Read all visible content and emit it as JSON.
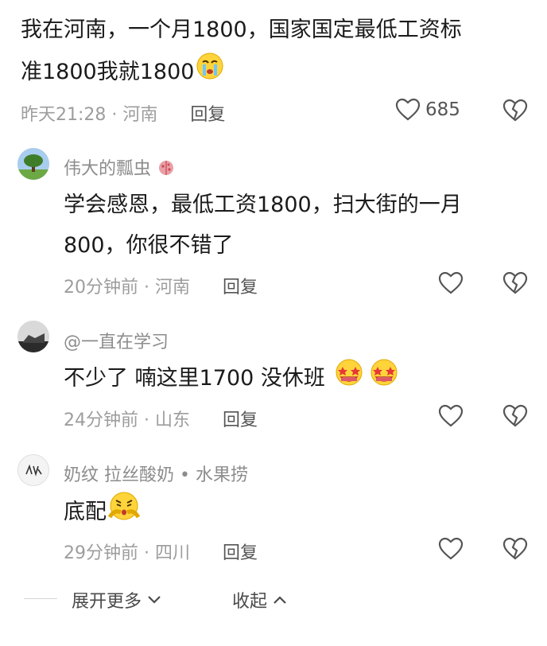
{
  "main_comment": {
    "line1": "我在河南，一个月1800，国家国定最低工资标",
    "line2": "准1800我就1800",
    "time": "昨天21:28",
    "location": "河南",
    "reply_label": "回复",
    "likes": "685"
  },
  "replies": [
    {
      "username": "伟大的瓢虫",
      "line1": "学会感恩，最低工资1800，扫大街的一月",
      "line2": "800，你很不错了",
      "time": "20分钟前",
      "location": "河南",
      "reply_label": "回复"
    },
    {
      "username": "@一直在学习",
      "line1": "不少了 喃这里1700 没休班",
      "time": "24分钟前",
      "location": "山东",
      "reply_label": "回复"
    },
    {
      "username": "奶纹 拉丝酸奶 • 水果捞",
      "line1": "底配",
      "time": "29分钟前",
      "location": "四川",
      "reply_label": "回复"
    }
  ],
  "footer": {
    "expand_label": "展开更多",
    "collapse_label": "收起"
  },
  "icons": {
    "like": "heart-outline-icon",
    "dislike": "broken-heart-icon"
  }
}
